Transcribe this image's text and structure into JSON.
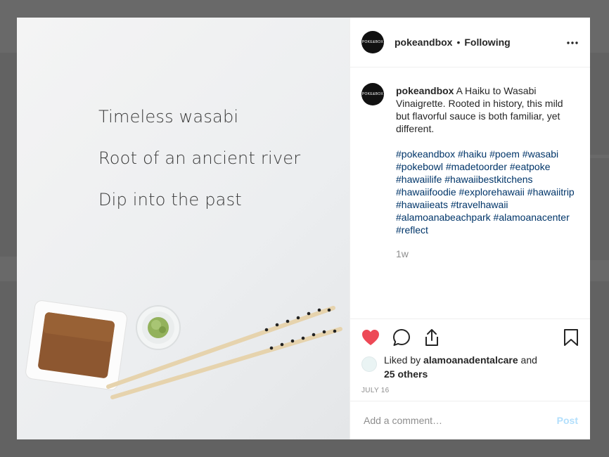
{
  "post": {
    "username": "pokeandbox",
    "follow_status": "Following",
    "avatar_text": "POKE&BOX",
    "caption": "A Haiku to Wasabi Vinaigrette. Rooted in history, this mild but flavorful sauce is both familiar, yet different.",
    "hashtags": "#pokeandbox #haiku #poem #wasabi #pokebowl #madetoorder #eatpoke #hawaiilife #hawaiibestkitchens #hawaiifoodie #explorehawaii #hawaiitrip #hawaiieats #travelhawaii #alamoanabeachpark #alamoanacenter #reflect",
    "age": "1w",
    "liked_by_prefix": "Liked by ",
    "liked_by_user": "alamoanadentalcare",
    "liked_by_and": " and",
    "liked_by_others": "25 others",
    "date": "JULY 16",
    "comment_placeholder": "Add a comment…",
    "post_label": "Post"
  },
  "image": {
    "haiku": [
      "Timeless wasabi",
      "Root of an ancient river",
      "Dip into the past"
    ]
  },
  "colors": {
    "like": "#ed4956",
    "hashtag": "#003569",
    "post_disabled": "#b2dffc"
  },
  "icons": [
    "more-icon",
    "heart-icon",
    "comment-icon",
    "share-icon",
    "bookmark-icon"
  ]
}
